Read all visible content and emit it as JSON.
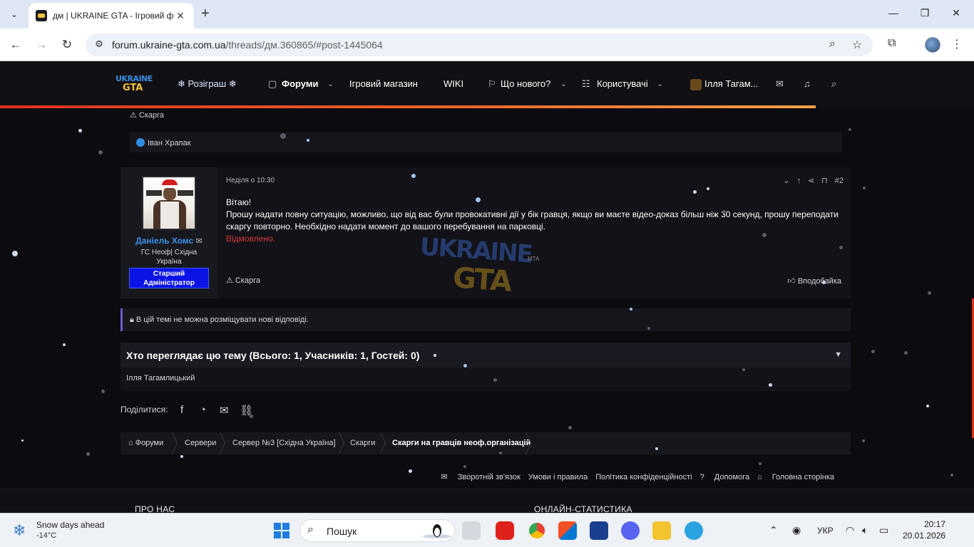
{
  "browser": {
    "tab_title": "дм | UKRAINE GTA - Ігровий фо",
    "url_host": "forum.ukraine-gta.com.ua",
    "url_path": "/threads/дм.360865/#post-1445064"
  },
  "site_nav": {
    "logo_top": "UKRAINE",
    "logo_bottom": "GTA",
    "giveaway": "❄ Розіграш ❄",
    "forums": "Форуми",
    "shop": "Ігровий магазин",
    "wiki": "WIKI",
    "whats_new": "Що нового?",
    "users": "Користувачі",
    "current_user": "Ілля Тагам..."
  },
  "previous_post": {
    "report": "Скарга",
    "liked_by": "Іван Храпак"
  },
  "post": {
    "username": "Даніель Хомс",
    "user_title": "ГС Неоф| Східна Україна",
    "user_banner": "Старший Адміністратор",
    "date": "Неділя о 10:30",
    "number": "#2",
    "line1": "Вітаю!",
    "line2": "Прошу надати повну ситуацію, можливо, що від вас були провокативні дії у бік гравця, якщо ви маєте відео-доказ більш ніж 30 секунд, прошу переподати скаргу повторно. Необхідно надати момент до вашого перебування на парковці.",
    "line3": "Відмовлено.",
    "report": "Скарга",
    "like": "Вподобайка"
  },
  "watermark": {
    "top": "UKRAINE",
    "bottom": "GTA",
    "tag": "MTA"
  },
  "locked_notice": "В цій темі не можна розміщувати нові відповіді.",
  "viewers": {
    "title": "Хто переглядає цю тему (Всього: 1, Учасників: 1, Гостей: 0)",
    "names": "Ілля Тагамлицький"
  },
  "share_label": "Поділитися:",
  "breadcrumbs": [
    "Форуми",
    "Сервери",
    "Сервер №3 [Східна Україна]",
    "Скарги",
    "Скарги на гравців неоф.організацій"
  ],
  "footer_links": [
    "Зворотній зв'язок",
    "Умови і правила",
    "Політика конфіденційності",
    "Допомога",
    "Головна сторінка"
  ],
  "footer_headings": [
    "ПРО НАС",
    "ОНЛАЙН-СТАТИСТИКА"
  ],
  "taskbar": {
    "weather_title": "Snow days ahead",
    "weather_temp": "-14°C",
    "search_placeholder": "Пошук",
    "language": "УКР",
    "time": "20:17",
    "date": "20.01.2026"
  },
  "colors": {
    "accent_orange": "#e0301c",
    "username_blue": "#3a91e8",
    "declined_red": "#d33b3b",
    "admin_banner": "#0a14e6"
  }
}
